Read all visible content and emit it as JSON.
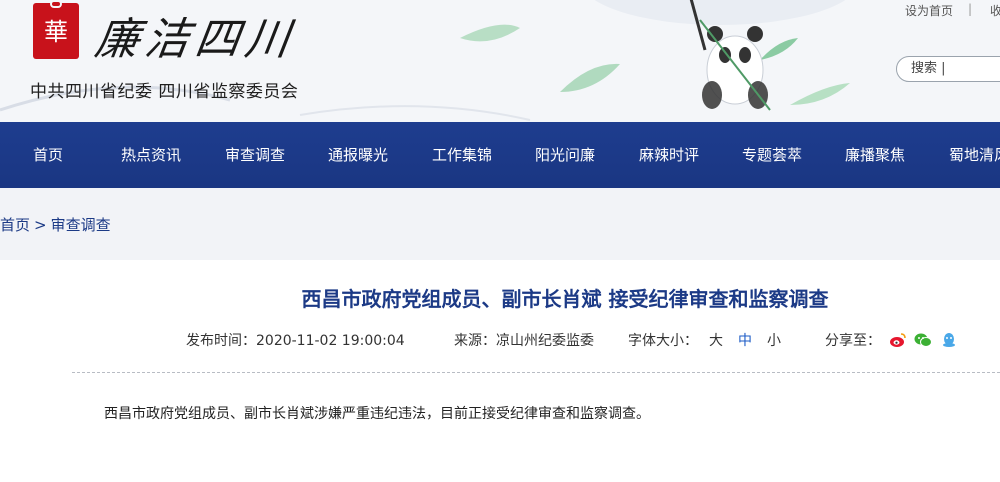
{
  "header": {
    "seal_char": "華",
    "logo_text": "廉洁四川",
    "org_name": "中共四川省纪委 四川省监察委员会",
    "top_links": [
      "设为首页",
      "|",
      "收"
    ],
    "search_placeholder": "搜索 |"
  },
  "nav": {
    "items": [
      "首页",
      "热点资讯",
      "审查调查",
      "通报曝光",
      "工作集锦",
      "阳光问廉",
      "麻辣时评",
      "专题荟萃",
      "廉播聚焦",
      "蜀地清风"
    ]
  },
  "breadcrumb": {
    "home": "首页",
    "separator": ">",
    "current": "审查调查"
  },
  "article": {
    "title": "西昌市政府党组成员、副市长肖斌 接受纪律审查和监察调查",
    "publish_label": "发布时间：2020-11-02 19:00:04",
    "source_label": "来源：凉山州纪委监委",
    "font_size_label": "字体大小：",
    "font_sizes": [
      "大",
      "中",
      "小"
    ],
    "share_label": "分享至：",
    "share_icons": [
      "weibo-icon",
      "wechat-icon",
      "qq-icon"
    ],
    "body": "西昌市政府党组成员、副市长肖斌涉嫌严重违纪违法，目前正接受纪律审查和监察调查。"
  },
  "colors": {
    "nav_bg": "#1e3d8f",
    "title": "#1c3a86",
    "seal": "#c8121b",
    "weibo": "#e6162d",
    "wechat": "#3cb034",
    "qq": "#4aa8e8"
  }
}
